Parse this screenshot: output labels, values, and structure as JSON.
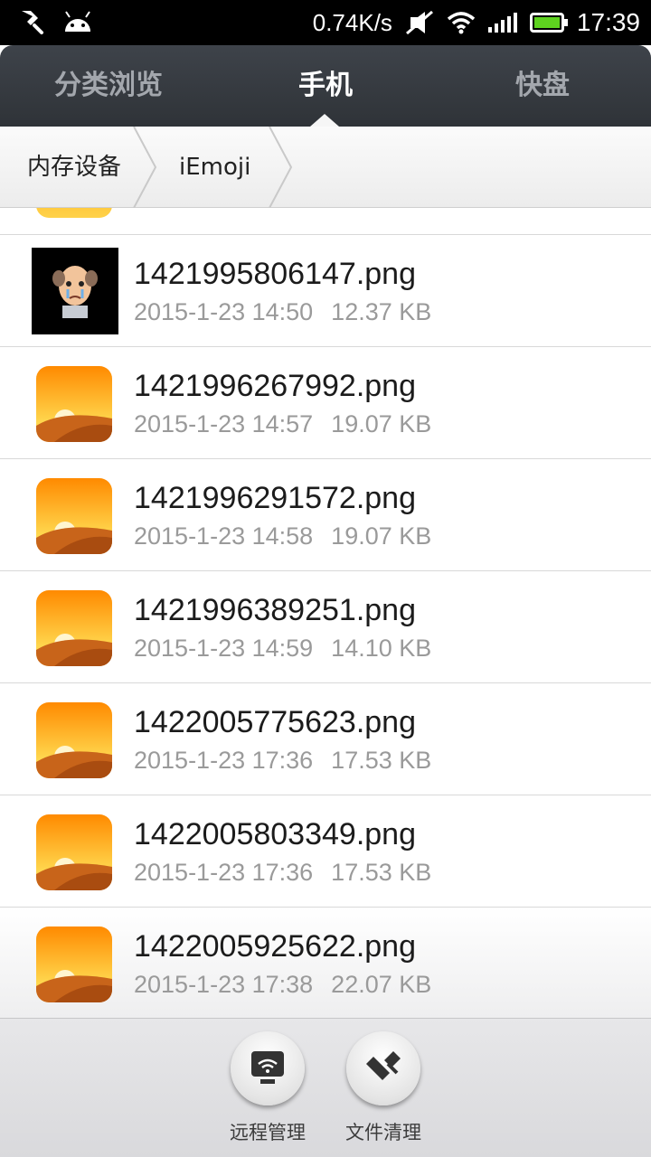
{
  "status_bar": {
    "net_speed": "0.74K/s",
    "time": "17:39",
    "icons": [
      "cleaner-icon",
      "android-icon",
      "mute-icon",
      "wifi-icon",
      "signal-icon",
      "battery-icon"
    ]
  },
  "tabs": [
    {
      "label": "分类浏览",
      "active": false
    },
    {
      "label": "手机",
      "active": true
    },
    {
      "label": "快盘",
      "active": false
    }
  ],
  "breadcrumb": [
    "内存设备",
    "iEmoji"
  ],
  "files": [
    {
      "name": "1421995806147.png",
      "date": "2015-1-23 14:50",
      "size": "12.37 KB",
      "thumb": "photo"
    },
    {
      "name": "1421996267992.png",
      "date": "2015-1-23 14:57",
      "size": "19.07 KB",
      "thumb": "image"
    },
    {
      "name": "1421996291572.png",
      "date": "2015-1-23 14:58",
      "size": "19.07 KB",
      "thumb": "image"
    },
    {
      "name": "1421996389251.png",
      "date": "2015-1-23 14:59",
      "size": "14.10 KB",
      "thumb": "image"
    },
    {
      "name": "1422005775623.png",
      "date": "2015-1-23 17:36",
      "size": "17.53 KB",
      "thumb": "image"
    },
    {
      "name": "1422005803349.png",
      "date": "2015-1-23 17:36",
      "size": "17.53 KB",
      "thumb": "image"
    },
    {
      "name": "1422005925622.png",
      "date": "2015-1-23 17:38",
      "size": "22.07 KB",
      "thumb": "image"
    }
  ],
  "toolbar": {
    "remote_label": "远程管理",
    "clean_label": "文件清理"
  },
  "colors": {
    "tab_bg": "#363a40",
    "active_tab_text": "#ffffff",
    "inactive_tab_text": "#a3a7ad",
    "battery_fill": "#5ed21f"
  }
}
